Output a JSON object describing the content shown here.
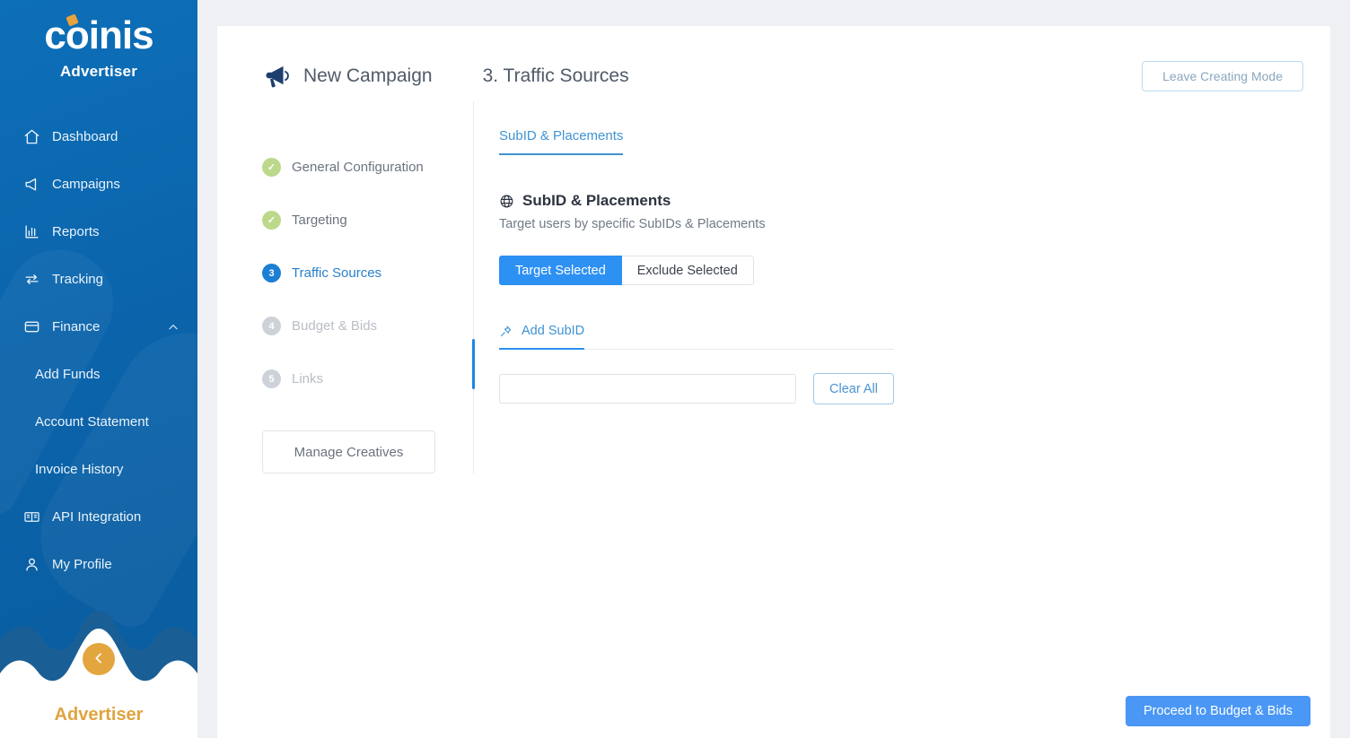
{
  "sidebar": {
    "logo_text": "coinis",
    "logo_subtitle": "Advertiser",
    "bottom_label": "Advertiser",
    "items": [
      {
        "label": "Dashboard",
        "icon": "home-icon"
      },
      {
        "label": "Campaigns",
        "icon": "megaphone-icon"
      },
      {
        "label": "Reports",
        "icon": "bar-chart-icon"
      },
      {
        "label": "Tracking",
        "icon": "arrows-swap-icon"
      },
      {
        "label": "Finance",
        "icon": "card-icon",
        "expanded": true,
        "chevron": "chevron-up-icon"
      },
      {
        "label": "Add Funds",
        "sub": true
      },
      {
        "label": "Account Statement",
        "sub": true
      },
      {
        "label": "Invoice History",
        "sub": true
      },
      {
        "label": "API Integration",
        "icon": "book-icon"
      },
      {
        "label": "My Profile",
        "icon": "user-icon"
      }
    ],
    "collapse_icon": "chevron-left-icon"
  },
  "header": {
    "icon": "megaphone-icon",
    "title": "New Campaign",
    "step_title": "3. Traffic Sources",
    "leave_button": "Leave Creating Mode"
  },
  "steps": {
    "items": [
      {
        "badge": "✓",
        "label": "General Configuration",
        "state": "done"
      },
      {
        "badge": "✓",
        "label": "Targeting",
        "state": "done"
      },
      {
        "badge": "3",
        "label": "Traffic Sources",
        "state": "current"
      },
      {
        "badge": "4",
        "label": "Budget & Bids",
        "state": "todo"
      },
      {
        "badge": "5",
        "label": "Links",
        "state": "todo"
      }
    ],
    "manage_creatives": "Manage Creatives"
  },
  "panel": {
    "tab_label": "SubID & Placements",
    "section_icon": "globe-icon",
    "section_title": "SubID & Placements",
    "section_subtitle": "Target users by specific SubIDs & Placements",
    "segmented": {
      "target_label": "Target Selected",
      "exclude_label": "Exclude Selected",
      "selected": "Target Selected"
    },
    "subtab_icon": "pin-icon",
    "subtab_label": "Add SubID",
    "input_value": "",
    "input_placeholder": "",
    "clear_button": "Clear All"
  },
  "footer": {
    "proceed_button": "Proceed to Budget & Bids"
  },
  "colors": {
    "sidebar_blue": "#0b64ab",
    "accent_orange": "#e3a63f",
    "primary_blue": "#2d90f3",
    "step_done_green": "#bcd88b",
    "step_current_blue": "#1b7fd4"
  }
}
